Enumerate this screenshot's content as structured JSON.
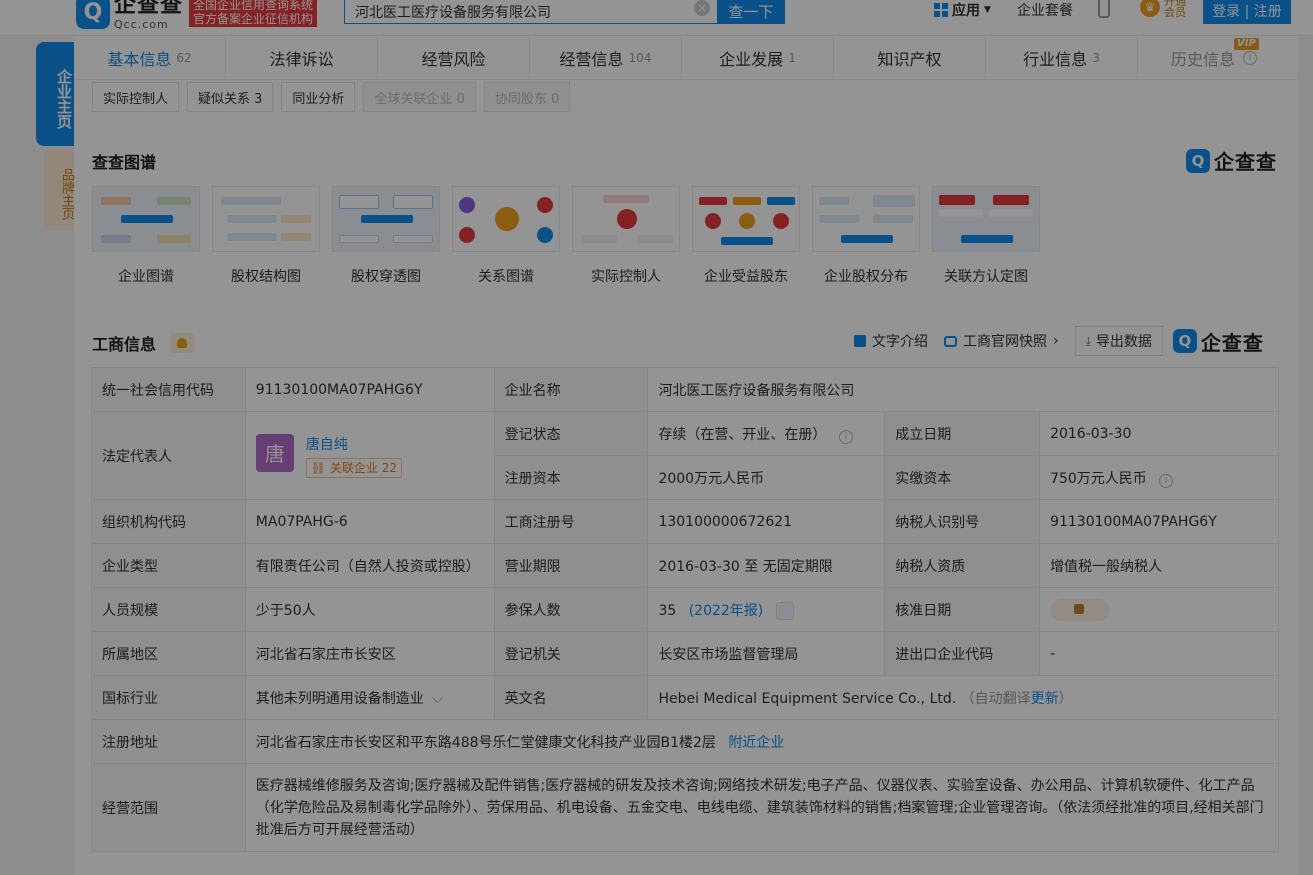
{
  "header": {
    "logo_cn": "企查查",
    "logo_en": "Qcc.com",
    "logo_tag_line1": "全国企业信用查询系统",
    "logo_tag_line2": "官方备案企业征信机构",
    "search_value": "河北医工医疗设备服务有限公司",
    "search_button": "查一下",
    "app_label": "应用",
    "enterprise_package": "企业套餐",
    "vip_label": "开通会员",
    "login_label": "登录 | 注册"
  },
  "side": {
    "main_label": "企业主页",
    "brand_label": "品牌主页"
  },
  "tabs": [
    {
      "label": "基本信息",
      "count": "62"
    },
    {
      "label": "法律诉讼",
      "count": ""
    },
    {
      "label": "经营风险",
      "count": ""
    },
    {
      "label": "经营信息",
      "count": "104"
    },
    {
      "label": "企业发展",
      "count": "1"
    },
    {
      "label": "知识产权",
      "count": ""
    },
    {
      "label": "行业信息",
      "count": "3"
    },
    {
      "label": "历史信息",
      "count": "",
      "badge": "VIP"
    }
  ],
  "subtabs": [
    {
      "label": "实际控制人"
    },
    {
      "label": "疑似关系 3"
    },
    {
      "label": "同业分析"
    },
    {
      "label": "全球关联企业 0"
    },
    {
      "label": "协同股东 0"
    }
  ],
  "graph_section": {
    "title": "查查图谱",
    "brand": "企查查",
    "items": [
      {
        "label": "企业图谱"
      },
      {
        "label": "股权结构图"
      },
      {
        "label": "股权穿透图"
      },
      {
        "label": "关系图谱"
      },
      {
        "label": "实际控制人"
      },
      {
        "label": "企业受益股东"
      },
      {
        "label": "企业股权分布"
      },
      {
        "label": "关联方认定图"
      }
    ]
  },
  "business_section": {
    "title": "工商信息",
    "text_intro": "文字介绍",
    "snapshot": "工商官网快照",
    "export": "导出数据",
    "brand": "企查查"
  },
  "info": {
    "credit_code_k": "统一社会信用代码",
    "credit_code_v": "91130100MA07PAHG6Y",
    "company_name_k": "企业名称",
    "company_name_v": "河北医工医疗设备服务有限公司",
    "legal_rep_k": "法定代表人",
    "legal_rep_avatar": "唐",
    "legal_rep_name": "唐自纯",
    "legal_rep_related": "关联企业",
    "legal_rep_related_count": "22",
    "reg_status_k": "登记状态",
    "reg_status_v": "存续（在营、开业、在册）",
    "found_date_k": "成立日期",
    "found_date_v": "2016-03-30",
    "reg_capital_k": "注册资本",
    "reg_capital_v": "2000万元人民币",
    "paid_capital_k": "实缴资本",
    "paid_capital_v": "750万元人民币",
    "org_code_k": "组织机构代码",
    "org_code_v": "MA07PAHG-6",
    "reg_no_k": "工商注册号",
    "reg_no_v": "130100000672621",
    "taxpayer_id_k": "纳税人识别号",
    "taxpayer_id_v": "91130100MA07PAHG6Y",
    "type_k": "企业类型",
    "type_v": "有限责任公司（自然人投资或控股）",
    "term_k": "营业期限",
    "term_v": "2016-03-30 至 无固定期限",
    "tax_qual_k": "纳税人资质",
    "tax_qual_v": "增值税一般纳税人",
    "staff_k": "人员规模",
    "staff_v": "少于50人",
    "insured_k": "参保人数",
    "insured_v": "35",
    "insured_year": "(2022年报)",
    "approve_k": "核准日期",
    "region_k": "所属地区",
    "region_v": "河北省石家庄市长安区",
    "authority_k": "登记机关",
    "authority_v": "长安区市场监督管理局",
    "ie_code_k": "进出口企业代码",
    "ie_code_v": "-",
    "industry_k": "国标行业",
    "industry_v": "其他未列明通用设备制造业",
    "en_name_k": "英文名",
    "en_name_v": "Hebei Medical Equipment Service Co., Ltd.",
    "en_auto_prefix": "（自动翻译",
    "en_update": "更新",
    "en_auto_suffix": "）",
    "address_k": "注册地址",
    "address_v": "河北省石家庄市长安区和平东路488号乐仁堂健康文化科技产业园B1楼2层",
    "nearby": "附近企业",
    "scope_k": "经营范围",
    "scope_v": "医疗器械维修服务及咨询;医疗器械及配件销售;医疗器械的研发及技术咨询;网络技术研发;电子产品、仪器仪表、实验室设备、办公用品、计算机软硬件、化工产品（化学危险品及易制毒化学品除外）、劳保用品、机电设备、五金交电、电线电缆、建筑装饰材料的销售;档案管理;企业管理咨询。（依法须经批准的项目,经相关部门批准后方可开展经营活动）"
  }
}
